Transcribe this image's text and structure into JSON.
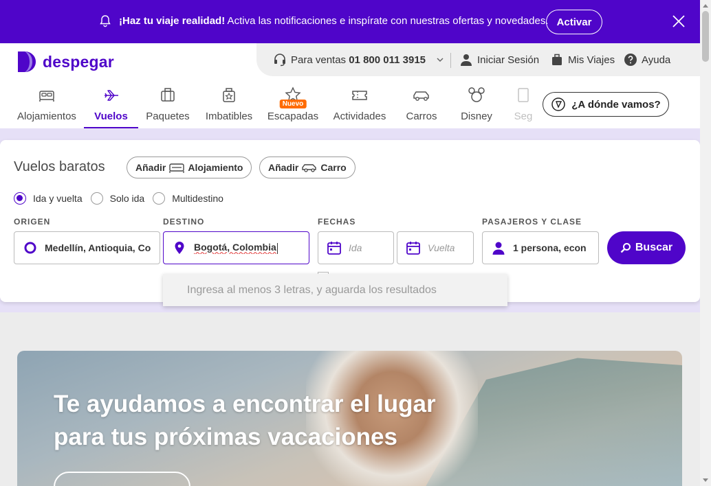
{
  "notification": {
    "title": "¡Haz tu viaje realidad!",
    "text": " Activa las notificaciones e inspírate con nuestras ofertas y novedades.",
    "button": "Activar"
  },
  "header": {
    "logo": "despegar",
    "sales_label": "Para ventas",
    "sales_phone": "01 800 011 3915",
    "login": "Iniciar Sesión",
    "trips": "Mis Viajes",
    "help": "Ayuda"
  },
  "nav": {
    "tabs": [
      "Alojamientos",
      "Vuelos",
      "Paquetes",
      "Imbatibles",
      "Escapadas",
      "Actividades",
      "Carros",
      "Disney",
      "Seg"
    ],
    "badge": "Nuevo",
    "where": "¿A dónde vamos?"
  },
  "search": {
    "title": "Vuelos baratos",
    "add_label": "Añadir",
    "add_hotel": "Alojamiento",
    "add_car": "Carro",
    "trip_types": [
      "Ida y vuelta",
      "Solo ida",
      "Multidestino"
    ],
    "labels": {
      "origin": "ORIGEN",
      "destination": "DESTINO",
      "dates": "FECHAS",
      "passengers": "PASAJEROS Y CLASE"
    },
    "origin_value": "Medellín, Antioquia, Co",
    "destination_value": "Bogotá, Colombia",
    "depart_placeholder": "Ida",
    "return_placeholder": "Vuelta",
    "passengers_value": "1 persona, econ",
    "search_button": "Buscar",
    "dropdown_hint": "Ingresa al menos 3 letras, y aguarda los resultados"
  },
  "hero": {
    "line1": "Te ayudamos a encontrar el lugar",
    "line2": "para tus próximas vacaciones"
  },
  "colors": {
    "brand": "#4f05c9",
    "badge": "#ff6b00"
  }
}
